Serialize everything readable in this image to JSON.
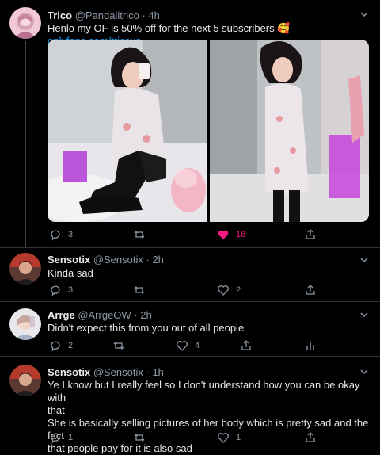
{
  "tweets": [
    {
      "name": "Trico",
      "handle": "@Pandalitrico",
      "time": "· 4h",
      "text": "Henlo my OF is 50% off for the next 5 subscribers 🥰",
      "link": "onlyfans.com/tricoxo",
      "replies": "3",
      "retweets": "",
      "likes": "16",
      "liked": true
    },
    {
      "name": "Sensotix",
      "handle": "@Sensotix",
      "time": "· 2h",
      "text": "Kinda sad",
      "replies": "3",
      "retweets": "",
      "likes": "2"
    },
    {
      "name": "Arrge",
      "handle": "@ArrgeOW",
      "time": "· 2h",
      "text": "Didn't expect this from you out of all people",
      "replies": "2",
      "retweets": "",
      "likes": "4"
    },
    {
      "name": "Sensotix",
      "handle": "@Sensotix",
      "time": "· 1h",
      "text_lines": [
        "Ye I know but I really feel so I don't understand how you can be okay with",
        "that",
        "She is basically selling pictures of her body which is pretty sad and the fact",
        "that people pay for it is also sad"
      ],
      "replies": "1",
      "retweets": "",
      "likes": "1"
    }
  ],
  "colors": {
    "background": "#000000",
    "link": "#1d9bf0",
    "like_active": "#f91880",
    "muted": "#8b98a5"
  }
}
